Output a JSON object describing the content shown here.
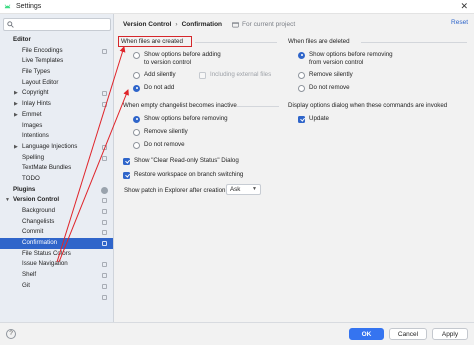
{
  "window": {
    "title": "Settings",
    "logo_icon": "android-icon",
    "close_icon": "close-icon"
  },
  "sidebar": {
    "search_placeholder": "",
    "items": [
      {
        "label": "Editor",
        "level": 0,
        "header": true
      },
      {
        "label": "File Encodings",
        "level": 1,
        "copy": true
      },
      {
        "label": "Live Templates",
        "level": 1
      },
      {
        "label": "File Types",
        "level": 1
      },
      {
        "label": "Layout Editor",
        "level": 1
      },
      {
        "label": "Copyright",
        "level": 1,
        "arrow": "right",
        "copy": true
      },
      {
        "label": "Inlay Hints",
        "level": 1,
        "arrow": "right",
        "copy": true
      },
      {
        "label": "Emmet",
        "level": 1,
        "arrow": "right"
      },
      {
        "label": "Images",
        "level": 1
      },
      {
        "label": "Intentions",
        "level": 1
      },
      {
        "label": "Language Injections",
        "level": 1,
        "arrow": "right",
        "copy": true
      },
      {
        "label": "Spelling",
        "level": 1,
        "copy": true
      },
      {
        "label": "TextMate Bundles",
        "level": 1
      },
      {
        "label": "TODO",
        "level": 1
      },
      {
        "label": "Plugins",
        "level": 0,
        "header": true,
        "badge": true
      },
      {
        "label": "Version Control",
        "level": 0,
        "header": true,
        "arrow": "down",
        "copy": true
      },
      {
        "label": "Background",
        "level": 1,
        "copy": true
      },
      {
        "label": "Changelists",
        "level": 1,
        "copy": true
      },
      {
        "label": "Commit",
        "level": 1,
        "copy": true
      },
      {
        "label": "Confirmation",
        "level": 1,
        "copy": true,
        "selected": true
      },
      {
        "label": "File Status Colors",
        "level": 1
      },
      {
        "label": "Issue Navigation",
        "level": 1,
        "copy": true
      },
      {
        "label": "Shelf",
        "level": 1,
        "copy": true
      },
      {
        "label": "Git",
        "level": 1,
        "copy": true
      },
      {
        "label": "",
        "level": 1,
        "copy": true
      }
    ]
  },
  "breadcrumb": {
    "parent": "Version Control",
    "separator": "›",
    "current": "Confirmation",
    "project_note": "For current project"
  },
  "reset_label": "Reset",
  "created": {
    "title": "When files are created",
    "options": [
      {
        "label": "Show options before adding",
        "label2": "to version control",
        "checked": false
      },
      {
        "label": "Add silently",
        "checked": false
      },
      {
        "label": "Do not add",
        "checked": true
      }
    ],
    "including_external": "Including external files"
  },
  "deleted": {
    "title": "When files are deleted",
    "options": [
      {
        "label": "Show options before removing",
        "label2": "from version control",
        "checked": true
      },
      {
        "label": "Remove silently",
        "checked": false
      },
      {
        "label": "Do not remove",
        "checked": false
      }
    ]
  },
  "changelist": {
    "title": "When empty changelist becomes inactive",
    "options": [
      {
        "label": "Show options before removing",
        "checked": true
      },
      {
        "label": "Remove silently",
        "checked": false
      },
      {
        "label": "Do not remove",
        "checked": false
      }
    ]
  },
  "display_dialog": {
    "title": "Display options dialog when these commands are invoked",
    "update_label": "Update",
    "update_checked": true
  },
  "misc": {
    "clear_readonly": "Show \"Clear Read-only Status\" Dialog",
    "restore_workspace": "Restore workspace on branch switching",
    "show_patch": "Show patch in Explorer after creation:",
    "patch_value": "Ask"
  },
  "buttons": {
    "ok": "OK",
    "cancel": "Cancel",
    "apply": "Apply",
    "help": "?"
  },
  "colors": {
    "accent": "#2f65ca",
    "highlight_box": "#d5272b",
    "annotation_arrow": "#e0242a"
  }
}
